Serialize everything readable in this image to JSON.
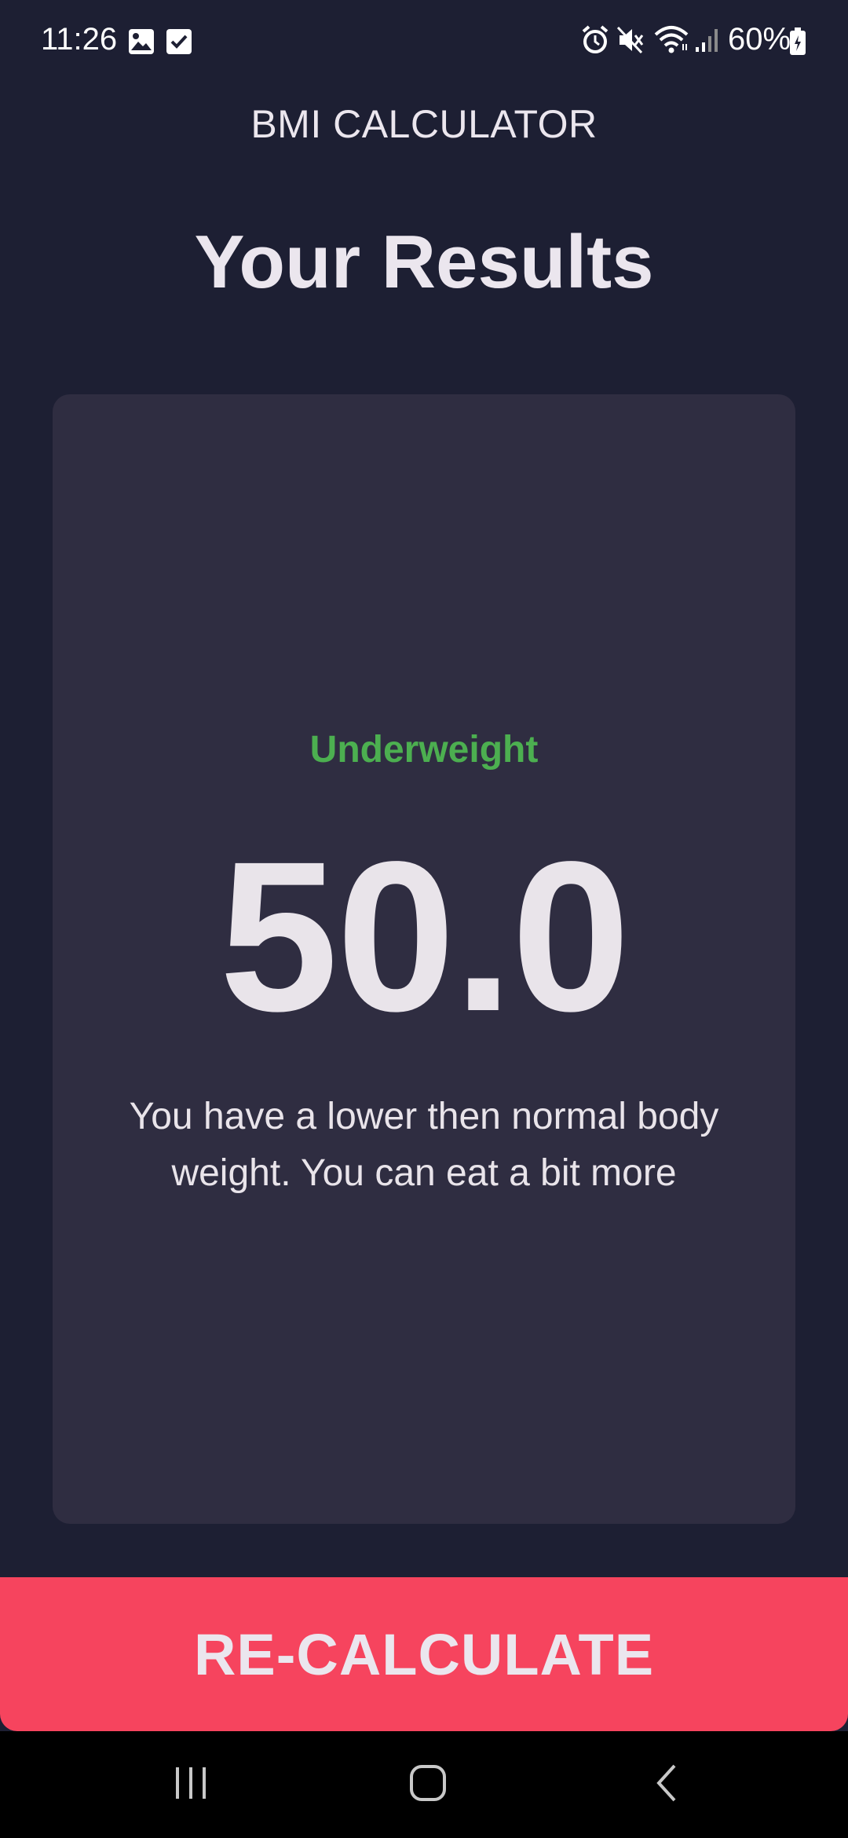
{
  "status_bar": {
    "time": "11:26",
    "battery": "60%",
    "left_icons": [
      "image-icon",
      "checkbox-icon"
    ],
    "right_icons": [
      "alarm-icon",
      "mute-icon",
      "wifi-icon",
      "signal-icon",
      "battery-icon"
    ]
  },
  "app_bar": {
    "title": "BMI CALCULATOR"
  },
  "page": {
    "title": "Your Results"
  },
  "result": {
    "status": "Underweight",
    "value": "50.0",
    "message": "You have a lower then normal body weight. You can eat a bit more"
  },
  "button": {
    "label": "RE-CALCULATE"
  },
  "nav_bar": {
    "buttons": [
      "recent-apps-icon",
      "home-icon",
      "back-icon"
    ]
  },
  "colors": {
    "background": "#1d1f33",
    "card": "#2f2d41",
    "status_green": "#4caf50",
    "button_red": "#f6445e",
    "text": "#ebe6ee"
  }
}
